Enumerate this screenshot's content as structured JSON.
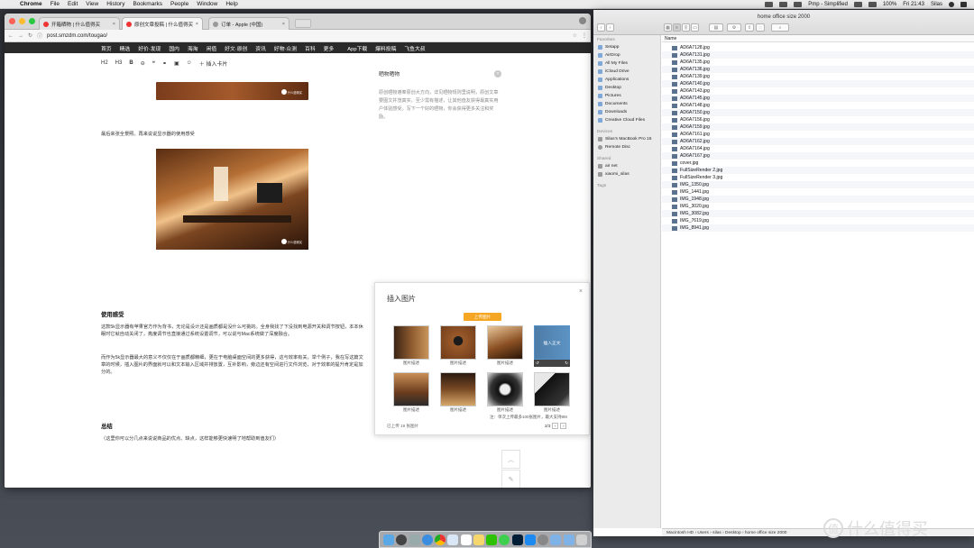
{
  "menubar": {
    "app": "Chrome",
    "items": [
      "File",
      "Edit",
      "View",
      "History",
      "Bookmarks",
      "People",
      "Window",
      "Help"
    ],
    "status": {
      "extra": "Pmp - Simplified",
      "battery": "100%",
      "clock": "Fri 21:43",
      "user": "Silas"
    }
  },
  "browser": {
    "tabs": [
      {
        "label": "开箱晒物 | 什么值得买"
      },
      {
        "label": "原创文章投稿 | 什么值得买"
      },
      {
        "label": "订单 - Apple (中国)"
      }
    ],
    "url": "post.smzdm.com/tougao/",
    "nav": [
      "首页",
      "精选",
      "好价·发现",
      "国内",
      "海淘",
      "闲值",
      "好文·原创",
      "资讯",
      "好物·众测",
      "百科",
      "更多",
      "App下载",
      "爆料投稿",
      "飞鱼大叔"
    ]
  },
  "editor": {
    "toolbar": {
      "h2": "H2",
      "h3": "H3",
      "bold": "B",
      "quote": "❝",
      "insert_card": "插入卡片"
    },
    "caption_intro": "最后来张全景照。再来说说显示器的使用感受",
    "section1_title": "使用感受",
    "section1_p1": "这款5k显示器有苹果官方作为背书，无论是设计还是画质都是没什么可挑的。全身我找了下没找到电源开关和调节按钮，本本休眠时它就自动关闭了，亮度调节也直接通过系统设置调节，可以说与Mac系统做了深度融合。",
    "section1_p2": "而作为5k显示器最大的意义不仅仅在于画质都精细，更在于电脑桌面空间的更多获得，这与效率有关，举个例子，我在写这篇文章的时候，插入图片的界面就可以和文本输入区域并排放置，互补影响，旁边还有空间进行文件浏览，对于效率的提升肯定是加分的。",
    "section2_title": "总结",
    "section2_p": "（这里你可以分几点来说说商品的优点、缺点，这样能够更快速明了地帮助到值友们）",
    "watermark": "什么值得买"
  },
  "side_panel": {
    "title": "晒物晒物",
    "body": "原创晒物遵奉原创大方向，详见晒物规则里说明，原创文章要图文并茂真实，至少需有描述，让其他值友获得最真实用户体验感受。写下一个好的晒物，你会获得更多关注和奖励。"
  },
  "insert_dialog": {
    "title": "插入图片",
    "upload_label": "上传图片",
    "captions": [
      "图片描述",
      "图片描述",
      "图片描述",
      "图片描述",
      "图片描述",
      "图片描述",
      "图片描述",
      "图片描述"
    ],
    "insert_label": "插入正文",
    "tip": "注：单次上传最多100张图片，最大支持8M",
    "count": "已上传 19 张图片",
    "page": "2/3",
    "prev": "‹",
    "next": "›"
  },
  "float_buttons": {
    "top": "︿",
    "edit": "✎"
  },
  "finder": {
    "title": "home office size 2000",
    "list_header": "Name",
    "sidebar": {
      "favorites_label": "Favorites",
      "favorites": [
        "Setapp",
        "AirDrop",
        "All My Files",
        "iCloud Drive",
        "Applications",
        "Desktop",
        "Pictures",
        "Documents",
        "Downloads",
        "Creative Cloud Files"
      ],
      "devices_label": "Devices",
      "devices": [
        "Silas's MacBook Pro 15",
        "Remote Disc"
      ],
      "shared_label": "Shared",
      "shared": [
        "air net",
        "xiaomi_silas"
      ],
      "tags_label": "Tags"
    },
    "files": [
      "AD6A7128.jpg",
      "AD6A7131.jpg",
      "AD6A7135.jpg",
      "AD6A7136.jpg",
      "AD6A7139.jpg",
      "AD6A7140.jpg",
      "AD6A7143.jpg",
      "AD6A7145.jpg",
      "AD6A7148.jpg",
      "AD6A7150.jpg",
      "AD6A7156.jpg",
      "AD6A7159.jpg",
      "AD6A7161.jpg",
      "AD6A7162.jpg",
      "AD6A7164.jpg",
      "AD6A7167.jpg",
      "cover.jpg",
      "FullSizeRender 2.jpg",
      "FullSizeRender 3.jpg",
      "IMG_1350.jpg",
      "IMG_1441.jpg",
      "IMG_1948.jpg",
      "IMG_3020.jpg",
      "IMG_3082.jpg",
      "IMG_7619.jpg",
      "IMG_8941.jpg"
    ],
    "path": "Macintosh HD › Users › silas › Desktop › home office size 2000"
  },
  "watermark_brand": "什么值得买",
  "colors": {
    "nav_bg": "#2a2a2a",
    "upload_btn": "#f5a623",
    "insert_overlay": "#2d7dc8"
  }
}
